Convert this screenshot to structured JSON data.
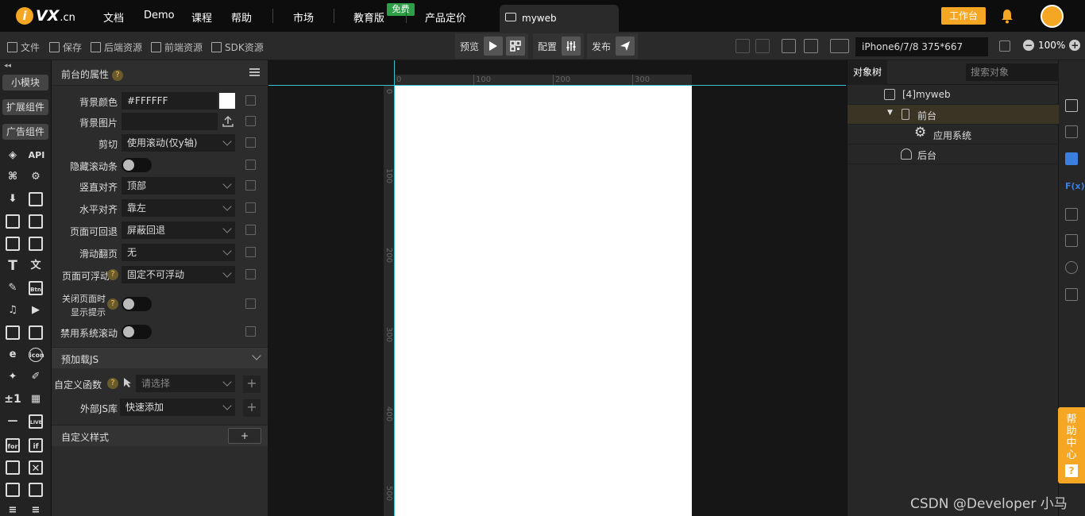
{
  "topnav": {
    "logo_i": "i",
    "logo_vx": "VX",
    "logo_cn": ".cn",
    "items": [
      "文档",
      "Demo",
      "课程",
      "帮助",
      "市场",
      "教育版",
      "产品定价"
    ],
    "free_badge": "免费",
    "tab_label": "myweb",
    "workbench": "工作台"
  },
  "toolbar": {
    "file": "文件",
    "save": "保存",
    "backend": "后端资源",
    "frontend": "前端资源",
    "sdk": "SDK资源",
    "preview": "预览",
    "config": "配置",
    "publish": "发布",
    "device": "iPhone6/7/8 375*667",
    "zoom": "100%"
  },
  "palette": {
    "collapse": "◂◂",
    "btn_module": "小模块",
    "btn_ext": "扩展组件",
    "btn_ad": "广告组件",
    "api": "API"
  },
  "props": {
    "title": "前台的属性",
    "bg_color_label": "背景颜色",
    "bg_color_value": "#FFFFFF",
    "bg_image_label": "背景图片",
    "clip_label": "剪切",
    "clip_value": "使用滚动(仅y轴)",
    "hide_scroll_label": "隐藏滚动条",
    "valign_label": "竖直对齐",
    "valign_value": "顶部",
    "halign_label": "水平对齐",
    "halign_value": "靠左",
    "back_label": "页面可回退",
    "back_value": "屏蔽回退",
    "swipe_label": "滑动翻页",
    "swipe_value": "无",
    "float_label": "页面可浮动",
    "float_value": "固定不可浮动",
    "close_tip_line1": "关闭页面时",
    "close_tip_line2": "显示提示",
    "disable_scroll_label": "禁用系统滚动",
    "preload_title": "预加载JS",
    "custom_fn_label": "自定义函数",
    "custom_fn_placeholder": "请选择",
    "ext_js_label": "外部JS库",
    "ext_js_value": "快速添加",
    "custom_style_title": "自定义样式",
    "add": "+",
    "help": "?"
  },
  "ruler": {
    "top": [
      "0",
      "100",
      "200",
      "300"
    ],
    "left": [
      "0",
      "100",
      "200",
      "300",
      "400",
      "500"
    ]
  },
  "tree": {
    "tab": "对象树",
    "search_placeholder": "搜索对象",
    "nodes": [
      "[4]myweb",
      "前台",
      "应用系统",
      "后台"
    ]
  },
  "help_center": {
    "text": "帮助中心",
    "q": "?"
  },
  "watermark": "CSDN @Developer 小马",
  "colors": {
    "accent": "#f5a623",
    "guide": "#39c0d0",
    "free": "#2e9e47"
  }
}
